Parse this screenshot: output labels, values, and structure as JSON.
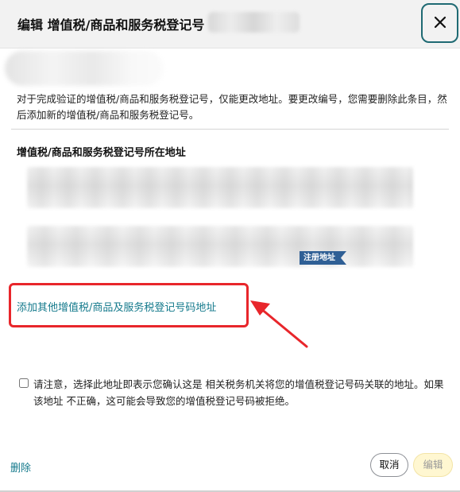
{
  "header": {
    "title": "编辑 增值税/商品和服务税登记号"
  },
  "info_text": "对于完成验证的增值税/商品和服务税登记号，仅能更改地址。要更改编号，您需要删除此条目，然后添加新的增值税/商品和服务税登记号。",
  "address_section": {
    "title": "增值税/商品和服务税登记号所在地址",
    "registered_badge": "注册地址"
  },
  "add_address_link": "添加其他增值税/商品及服务税登记号码地址",
  "confirm": {
    "text": "请注意，选择此地址即表示您确认这是 相关税务机关将您的增值税登记号码关联的地址。如果该地址 不正确，这可能会导致您的增值税登记号码被拒绝。",
    "checked": false
  },
  "footer": {
    "delete_label": "删除",
    "cancel_label": "取消",
    "edit_label": "编辑"
  },
  "colors": {
    "link": "#157a8c",
    "highlight": "#e8262b",
    "badge": "#2f5f95",
    "close_border": "#1f6a73",
    "edit_button_bg": "#fff7d1"
  },
  "icons": {
    "close": "close-icon",
    "annotation_arrow": "annotation-arrow-icon"
  }
}
